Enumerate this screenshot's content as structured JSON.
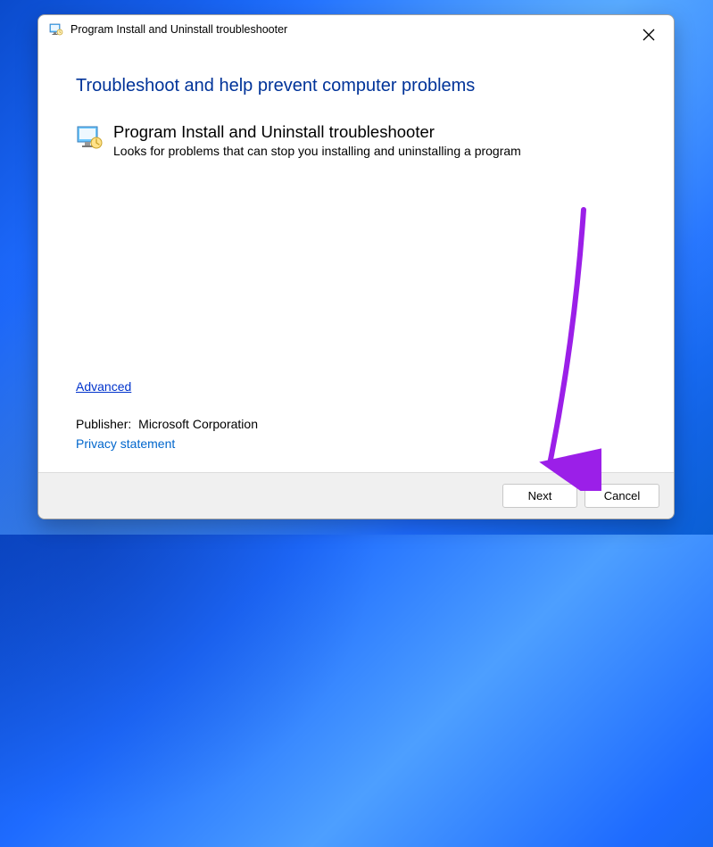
{
  "titlebar": {
    "text": "Program Install and Uninstall troubleshooter"
  },
  "heading": "Troubleshoot and help prevent computer problems",
  "program": {
    "title": "Program Install and Uninstall troubleshooter",
    "description": "Looks for problems that can stop you installing and uninstalling a program"
  },
  "links": {
    "advanced": "Advanced",
    "privacy": "Privacy statement"
  },
  "publisher": {
    "label": "Publisher:",
    "name": "Microsoft Corporation"
  },
  "buttons": {
    "next": "Next",
    "cancel": "Cancel"
  }
}
